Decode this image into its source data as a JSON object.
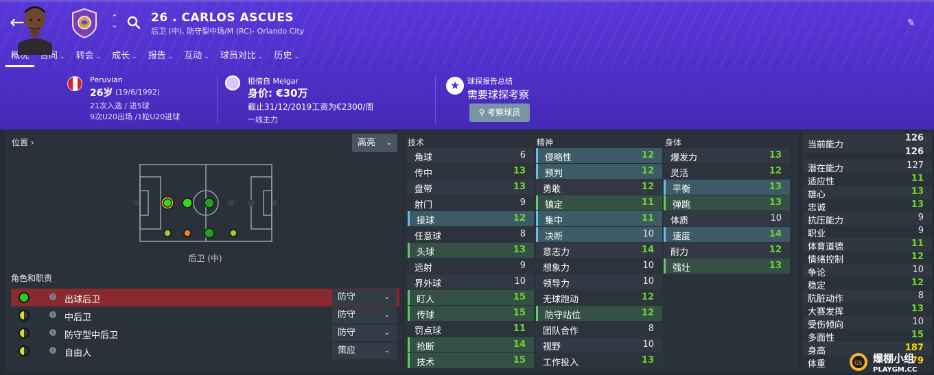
{
  "header": {
    "player_title": "26 . CARLOS ASCUES",
    "player_subtitle": "后卫 (中), 防守型中场/M (RC)- Orlando City",
    "tabs": [
      {
        "label": "概况",
        "active": true
      },
      {
        "label": "合同"
      },
      {
        "label": "转会"
      },
      {
        "label": "成长"
      },
      {
        "label": "报告"
      },
      {
        "label": "互动"
      },
      {
        "label": "球员对比"
      },
      {
        "label": "历史"
      }
    ],
    "accent_color": "#5a36d8"
  },
  "bio": {
    "nationality": "Peruvian",
    "age": "26岁",
    "dob": "(19/6/1992)",
    "caps": "21次入选 / 进5球",
    "u20": "9次U20出场 /1粒U20进球"
  },
  "contract": {
    "loan_from": "租借自 Melgar",
    "value": "身价: €30万",
    "wage": "截止31/12/2019工资为€2300/周",
    "squad_status": "一线主力"
  },
  "scout": {
    "title": "球探报告总结",
    "status": "需要球探考察",
    "button_label": "考察球员"
  },
  "position": {
    "title": "位置",
    "highlight_label": "高亮",
    "position_label": "后卫 (中)"
  },
  "roles": {
    "title": "角色和职责",
    "items": [
      {
        "name": "出球后卫",
        "duty": "防守",
        "selected": true,
        "dot_color": "#22d11e"
      },
      {
        "name": "中后卫",
        "duty": "防守",
        "selected": false,
        "dot_color": "half"
      },
      {
        "name": "防守型中后卫",
        "duty": "防守",
        "selected": false,
        "dot_color": "half"
      },
      {
        "name": "自由人",
        "duty": "策应",
        "selected": false,
        "dot_color": "half"
      }
    ]
  },
  "attributes": {
    "technical": {
      "title": "技术",
      "items": [
        {
          "name": "角球",
          "value": "6"
        },
        {
          "name": "传中",
          "value": "13"
        },
        {
          "name": "盘带",
          "value": "13"
        },
        {
          "name": "射门",
          "value": "9"
        },
        {
          "name": "接球",
          "value": "12"
        },
        {
          "name": "任意球",
          "value": "8"
        },
        {
          "name": "头球",
          "value": "13"
        },
        {
          "name": "远射",
          "value": "9"
        },
        {
          "name": "界外球",
          "value": "10"
        },
        {
          "name": "盯人",
          "value": "15"
        },
        {
          "name": "传球",
          "value": "15"
        },
        {
          "name": "罚点球",
          "value": "11"
        },
        {
          "name": "抢断",
          "value": "14"
        },
        {
          "name": "技术",
          "value": "15"
        }
      ]
    },
    "mental": {
      "title": "精神",
      "items": [
        {
          "name": "侵略性",
          "value": "12"
        },
        {
          "name": "预判",
          "value": "12"
        },
        {
          "name": "勇敢",
          "value": "12"
        },
        {
          "name": "镇定",
          "value": "11"
        },
        {
          "name": "集中",
          "value": "11"
        },
        {
          "name": "决断",
          "value": "10"
        },
        {
          "name": "意志力",
          "value": "14"
        },
        {
          "name": "想象力",
          "value": "10"
        },
        {
          "name": "领导力",
          "value": "10"
        },
        {
          "name": "无球跑动",
          "value": "12"
        },
        {
          "name": "防守站位",
          "value": "12"
        },
        {
          "name": "团队合作",
          "value": "8"
        },
        {
          "name": "视野",
          "value": "10"
        },
        {
          "name": "工作投入",
          "value": "13"
        }
      ]
    },
    "physical": {
      "title": "身体",
      "items": [
        {
          "name": "爆发力",
          "value": "13"
        },
        {
          "name": "灵活",
          "value": "12"
        },
        {
          "name": "平衡",
          "value": "13"
        },
        {
          "name": "弹跳",
          "value": "13"
        },
        {
          "name": "体质",
          "value": "10"
        },
        {
          "name": "速度",
          "value": "14"
        },
        {
          "name": "耐力",
          "value": "12"
        },
        {
          "name": "强壮",
          "value": "13"
        }
      ]
    }
  },
  "stats": {
    "current_ability_label": "当前能力",
    "current_ability_top": "126",
    "current_ability_value": "126",
    "items": [
      {
        "name": "潜在能力",
        "value": "127"
      },
      {
        "name": "适应性",
        "value": "11"
      },
      {
        "name": "雄心",
        "value": "13"
      },
      {
        "name": "忠诚",
        "value": "13"
      },
      {
        "name": "抗压能力",
        "value": "9"
      },
      {
        "name": "职业",
        "value": "9"
      },
      {
        "name": "体育道德",
        "value": "11"
      },
      {
        "name": "情绪控制",
        "value": "12"
      },
      {
        "name": "争论",
        "value": "10"
      },
      {
        "name": "稳定",
        "value": "12"
      },
      {
        "name": "肮脏动作",
        "value": "8"
      },
      {
        "name": "大赛发挥",
        "value": "13"
      },
      {
        "name": "受伤倾向",
        "value": "10"
      },
      {
        "name": "多面性",
        "value": "15"
      },
      {
        "name": "身高",
        "value": "187"
      },
      {
        "name": "体重",
        "value": "79"
      }
    ]
  },
  "watermark": {
    "title": "爆棚小组",
    "url": "PLAYGM.CC"
  }
}
